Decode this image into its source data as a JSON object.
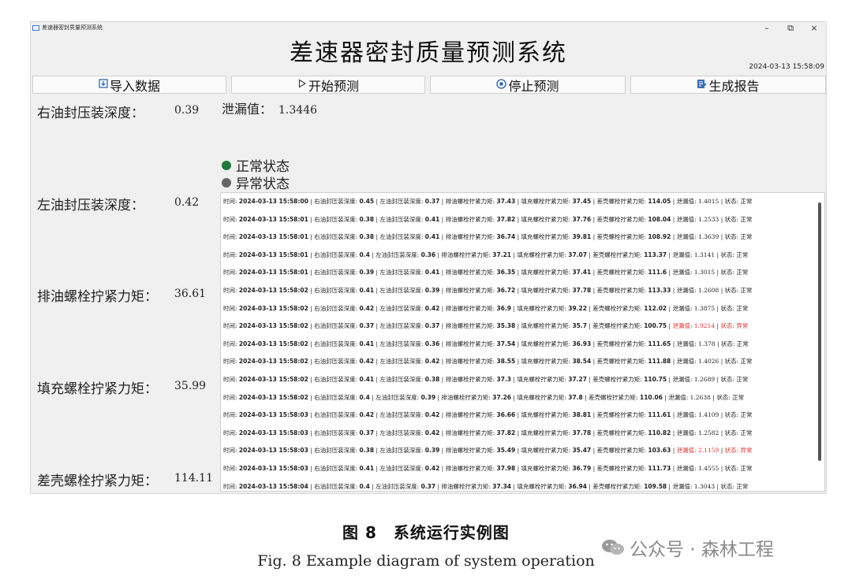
{
  "window": {
    "app_title": "差速器密封质量预测系统",
    "controls": {
      "minimize": "–",
      "maximize": "⧉",
      "close": "×"
    },
    "main_title": "差速器密封质量预测系统",
    "datetime": "2024-03-13 15:58:09"
  },
  "toolbar": {
    "import_label": "导入数据",
    "import_icon": "import-icon",
    "predict_label": "开始预测",
    "predict_icon": "play-icon",
    "stop_label": "停止预测",
    "stop_icon": "stop-icon",
    "report_label": "生成报告",
    "report_icon": "report-icon"
  },
  "params": [
    {
      "label": "右油封压装深度：",
      "value": "0.39"
    },
    {
      "label": "左油封压装深度：",
      "value": "0.42"
    },
    {
      "label": "排油螺栓拧紧力矩：",
      "value": "36.61"
    },
    {
      "label": "填充螺栓拧紧力矩：",
      "value": "35.99"
    },
    {
      "label": "差壳螺栓拧紧力矩：",
      "value": "114.11"
    }
  ],
  "leak": {
    "label": "泄漏值：",
    "value": "1.3446"
  },
  "legend": {
    "normal": "正常状态",
    "normal_color": "#1f7a3a",
    "abnormal": "异常状态",
    "abnormal_color": "#666666"
  },
  "log": {
    "labels": {
      "time": "时间:",
      "r": "右油封压装深度:",
      "l": "左油封压装深度:",
      "drain": "排油螺栓拧紧力矩:",
      "fill": "填充螺栓拧紧力矩:",
      "case": "差壳螺栓拧紧力矩:",
      "leak": "泄漏值:",
      "state": "状态:"
    },
    "rows": [
      {
        "t": "2024-03-13 15:58:00",
        "r": "0.45",
        "l": "0.37",
        "drain": "37.43",
        "fill": "37.45",
        "case": "114.05",
        "leak": "1.4015",
        "state": "正常"
      },
      {
        "t": "2024-03-13 15:58:01",
        "r": "0.38",
        "l": "0.41",
        "drain": "37.82",
        "fill": "37.76",
        "case": "108.04",
        "leak": "1.2533",
        "state": "正常"
      },
      {
        "t": "2024-03-13 15:58:01",
        "r": "0.38",
        "l": "0.41",
        "drain": "36.74",
        "fill": "39.81",
        "case": "108.92",
        "leak": "1.3639",
        "state": "正常"
      },
      {
        "t": "2024-03-13 15:58:01",
        "r": "0.4",
        "l": "0.36",
        "drain": "37.21",
        "fill": "37.07",
        "case": "113.37",
        "leak": "1.3141",
        "state": "正常"
      },
      {
        "t": "2024-03-13 15:58:01",
        "r": "0.39",
        "l": "0.41",
        "drain": "36.35",
        "fill": "37.41",
        "case": "111.6",
        "leak": "1.3015",
        "state": "正常"
      },
      {
        "t": "2024-03-13 15:58:02",
        "r": "0.41",
        "l": "0.39",
        "drain": "36.72",
        "fill": "37.78",
        "case": "113.33",
        "leak": "1.2608",
        "state": "正常"
      },
      {
        "t": "2024-03-13 15:58:02",
        "r": "0.42",
        "l": "0.42",
        "drain": "36.9",
        "fill": "39.22",
        "case": "112.02",
        "leak": "1.3875",
        "state": "正常"
      },
      {
        "t": "2024-03-13 15:58:02",
        "r": "0.37",
        "l": "0.37",
        "drain": "35.38",
        "fill": "35.7",
        "case": "100.75",
        "leak": "1.9214",
        "state": "异常",
        "abnormal": true
      },
      {
        "t": "2024-03-13 15:58:02",
        "r": "0.41",
        "l": "0.36",
        "drain": "37.54",
        "fill": "36.93",
        "case": "111.65",
        "leak": "1.378",
        "state": "正常"
      },
      {
        "t": "2024-03-13 15:58:02",
        "r": "0.42",
        "l": "0.42",
        "drain": "38.55",
        "fill": "38.54",
        "case": "111.88",
        "leak": "1.4026",
        "state": "正常"
      },
      {
        "t": "2024-03-13 15:58:02",
        "r": "0.41",
        "l": "0.38",
        "drain": "37.3",
        "fill": "37.27",
        "case": "110.75",
        "leak": "1.2689",
        "state": "正常"
      },
      {
        "t": "2024-03-13 15:58:02",
        "r": "0.4",
        "l": "0.39",
        "drain": "37.26",
        "fill": "37.8",
        "case": "110.06",
        "leak": "1.2638",
        "state": "正常"
      },
      {
        "t": "2024-03-13 15:58:03",
        "r": "0.42",
        "l": "0.42",
        "drain": "36.66",
        "fill": "38.81",
        "case": "111.61",
        "leak": "1.4109",
        "state": "正常"
      },
      {
        "t": "2024-03-13 15:58:03",
        "r": "0.37",
        "l": "0.42",
        "drain": "37.82",
        "fill": "37.78",
        "case": "110.82",
        "leak": "1.2582",
        "state": "正常"
      },
      {
        "t": "2024-03-13 15:58:03",
        "r": "0.38",
        "l": "0.39",
        "drain": "35.49",
        "fill": "35.47",
        "case": "103.63",
        "leak": "2.1159",
        "state": "异常",
        "abnormal": true
      },
      {
        "t": "2024-03-13 15:58:03",
        "r": "0.41",
        "l": "0.42",
        "drain": "37.98",
        "fill": "36.79",
        "case": "111.73",
        "leak": "1.4555",
        "state": "正常"
      },
      {
        "t": "2024-03-13 15:58:04",
        "r": "0.4",
        "l": "0.37",
        "drain": "37.34",
        "fill": "36.94",
        "case": "109.58",
        "leak": "1.3043",
        "state": "正常"
      }
    ]
  },
  "caption": {
    "cn": "图 8　系统运行实例图",
    "en": "Fig. 8  Example diagram of system operation"
  },
  "watermark": {
    "text": "公众号 · 森林工程",
    "icon": "wechat-icon"
  }
}
